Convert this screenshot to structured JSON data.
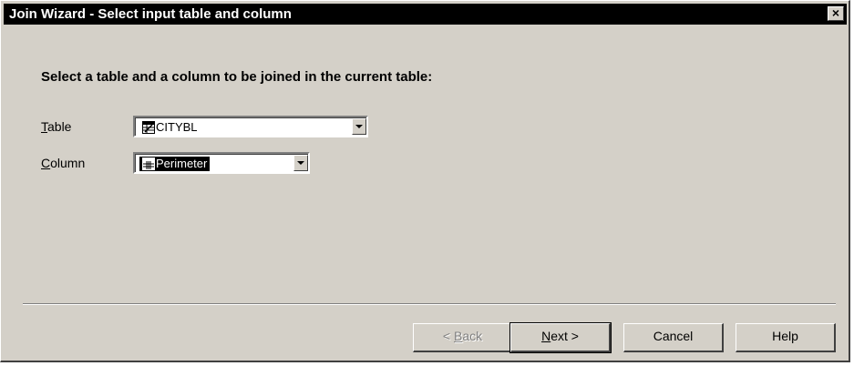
{
  "window": {
    "title": "Join Wizard - Select input table and column",
    "close_glyph": "×"
  },
  "instruction": "Select a table and a column to be joined in the current table:",
  "fields": {
    "table": {
      "label_mnemonic": "T",
      "label_rest": "able",
      "value": "CITYBL",
      "icon": "table-icon"
    },
    "column": {
      "label_mnemonic": "C",
      "label_rest": "olumn",
      "value": "Perimeter",
      "icon": "column-icon"
    }
  },
  "buttons": {
    "back": {
      "mnemonic": "B",
      "pre": "< ",
      "rest": "ack",
      "enabled": false
    },
    "next": {
      "mnemonic": "N",
      "pre": "",
      "rest": "ext >",
      "enabled": true
    },
    "cancel": {
      "label": "Cancel"
    },
    "help": {
      "label": "Help"
    }
  }
}
